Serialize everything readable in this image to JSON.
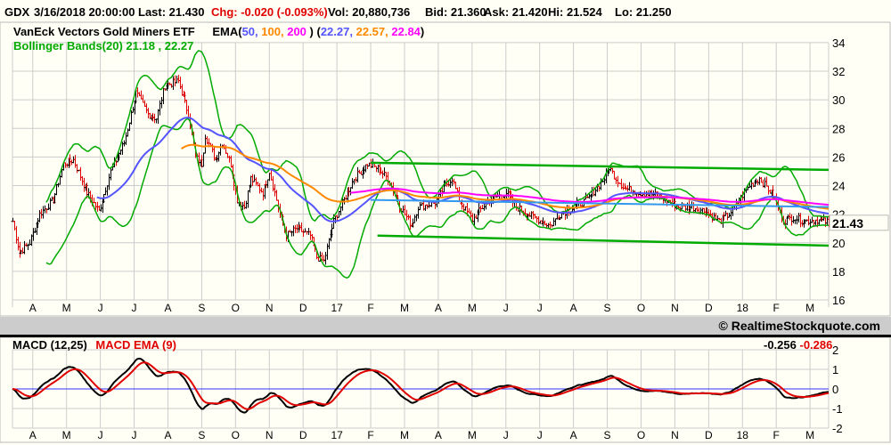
{
  "header": {
    "symbol": "GDX",
    "datetime": "3/16/2018 20:00:00",
    "last": "Last: 21.430",
    "chg": "Chg: -0.020 (-0.093%)",
    "vol": "Vol: 20,880,736",
    "bid": "Bid: 21.360",
    "ask": "Ask: 21.420",
    "hi": "Hi: 21.524",
    "lo": "Lo: 21.250"
  },
  "legend": {
    "name": "VanEck Vectors Gold Miners ETF",
    "ema_prefix": "EMA(",
    "ema_p1": "50,",
    "ema_p2": "100,",
    "ema_p3": "200",
    "ema_mid": " )  (",
    "ema_v1": "22.27,",
    "ema_v2": "22.57,",
    "ema_v3": "22.84",
    "ema_suffix": ")",
    "bollinger": "Bollinger Bands(20) 21.18 , 22.27"
  },
  "copyright": "© RealtimeStockquote.com",
  "macd_legend": {
    "macd": "MACD (12,25)",
    "signal": "MACD EMA (9)",
    "macd_value": "-0.256",
    "signal_value": "-0.286"
  },
  "colors": {
    "up": "#000000",
    "down": "#e00000",
    "ema50": "#5555ff",
    "ema100": "#ff8800",
    "ema200": "#ff00ff",
    "bollinger": "#00aa00",
    "regression": "#3399ee",
    "macd": "#000000",
    "signal": "#e00000",
    "zero": "#3333ff"
  },
  "chart_data": [
    {
      "type": "line",
      "title": "GDX price (OHLC bars) with EMA(50,100,200) and Bollinger Bands(20)",
      "x_unit": "months since Mar 2016",
      "x_range": [
        0.4,
        24.55
      ],
      "ylim": [
        16,
        34
      ],
      "yticks": [
        "16",
        "18",
        "20",
        "22",
        "24",
        "26",
        "28",
        "30",
        "32",
        "34"
      ],
      "month_ticks": [
        {
          "m": 1,
          "label": "A"
        },
        {
          "m": 2,
          "label": "M"
        },
        {
          "m": 3,
          "label": "J"
        },
        {
          "m": 4,
          "label": "J"
        },
        {
          "m": 5,
          "label": "A"
        },
        {
          "m": 6,
          "label": "S"
        },
        {
          "m": 7,
          "label": "O"
        },
        {
          "m": 8,
          "label": "N"
        },
        {
          "m": 9,
          "label": "D"
        },
        {
          "m": 10,
          "label": "17"
        },
        {
          "m": 11,
          "label": "F"
        },
        {
          "m": 12,
          "label": "M"
        },
        {
          "m": 13,
          "label": "A"
        },
        {
          "m": 14,
          "label": "M"
        },
        {
          "m": 15,
          "label": "J"
        },
        {
          "m": 16,
          "label": "J"
        },
        {
          "m": 17,
          "label": "A"
        },
        {
          "m": 18,
          "label": "S"
        },
        {
          "m": 19,
          "label": "O"
        },
        {
          "m": 20,
          "label": "N"
        },
        {
          "m": 21,
          "label": "D"
        },
        {
          "m": 22,
          "label": "18"
        },
        {
          "m": 23,
          "label": "F"
        },
        {
          "m": 24,
          "label": "M"
        }
      ],
      "last_price_label": "21.43",
      "last_price": 21.43,
      "close_anchors": [
        [
          0.4,
          21.5
        ],
        [
          0.6,
          19.3
        ],
        [
          0.9,
          20
        ],
        [
          1.2,
          22
        ],
        [
          1.6,
          23
        ],
        [
          1.9,
          25.5
        ],
        [
          2.2,
          25.8
        ],
        [
          2.6,
          23.5
        ],
        [
          2.95,
          22.2
        ],
        [
          3.3,
          25
        ],
        [
          3.7,
          27
        ],
        [
          4.05,
          30.5
        ],
        [
          4.4,
          29
        ],
        [
          4.65,
          28.7
        ],
        [
          4.9,
          31
        ],
        [
          5.3,
          31.3
        ],
        [
          5.6,
          29
        ],
        [
          5.8,
          26
        ],
        [
          6.0,
          25.5
        ],
        [
          6.1,
          27.5
        ],
        [
          6.4,
          25.8
        ],
        [
          6.6,
          27
        ],
        [
          6.85,
          25.5
        ],
        [
          7.05,
          23
        ],
        [
          7.25,
          22.5
        ],
        [
          7.45,
          24.5
        ],
        [
          7.8,
          23.5
        ],
        [
          8.0,
          25
        ],
        [
          8.3,
          22
        ],
        [
          8.5,
          20.5
        ],
        [
          8.8,
          21
        ],
        [
          9.2,
          20.5
        ],
        [
          9.4,
          19
        ],
        [
          9.6,
          18.7
        ],
        [
          9.9,
          21.5
        ],
        [
          10.2,
          23
        ],
        [
          10.5,
          24.5
        ],
        [
          10.9,
          25.5
        ],
        [
          11.2,
          25.2
        ],
        [
          11.5,
          24.5
        ],
        [
          11.8,
          22.8
        ],
        [
          12.2,
          21.2
        ],
        [
          12.4,
          22.5
        ],
        [
          12.9,
          22.8
        ],
        [
          13.2,
          24
        ],
        [
          13.4,
          24.5
        ],
        [
          13.6,
          23
        ],
        [
          14.0,
          21.6
        ],
        [
          14.2,
          22.2
        ],
        [
          14.5,
          23
        ],
        [
          15.0,
          23.5
        ],
        [
          15.3,
          22.5
        ],
        [
          15.8,
          21.8
        ],
        [
          16.3,
          21.2
        ],
        [
          16.6,
          22
        ],
        [
          17.0,
          22.5
        ],
        [
          17.4,
          23
        ],
        [
          17.9,
          24.5
        ],
        [
          18.05,
          25.3
        ],
        [
          18.25,
          24.5
        ],
        [
          18.5,
          23.8
        ],
        [
          19.0,
          23.5
        ],
        [
          19.5,
          23.3
        ],
        [
          20.1,
          22.5
        ],
        [
          20.5,
          22.5
        ],
        [
          20.9,
          22.2
        ],
        [
          21.3,
          21.5
        ],
        [
          21.6,
          22
        ],
        [
          21.9,
          23
        ],
        [
          22.2,
          24
        ],
        [
          22.5,
          24.5
        ],
        [
          22.9,
          23.3
        ],
        [
          23.2,
          21.5
        ],
        [
          23.5,
          21.8
        ],
        [
          23.8,
          21.5
        ],
        [
          24.2,
          21.6
        ],
        [
          24.55,
          21.43
        ]
      ],
      "trend_channel": {
        "upper": [
          [
            11.0,
            25.6
          ],
          [
            24.55,
            25.1
          ]
        ],
        "lower": [
          [
            11.2,
            20.5
          ],
          [
            24.55,
            19.8
          ]
        ]
      },
      "regression_line": [
        [
          11.0,
          23.0
        ],
        [
          24.55,
          22.5
        ]
      ],
      "ema_periods": [
        50,
        100,
        200
      ],
      "bollinger_period": 20
    },
    {
      "type": "line",
      "title": "MACD (12,25) with MACD EMA (9)",
      "ylim": [
        -2,
        2
      ],
      "yticks": [
        "-2",
        "-1",
        "0",
        "1",
        "2"
      ],
      "fast": 12,
      "slow": 25,
      "signal": 9
    }
  ]
}
